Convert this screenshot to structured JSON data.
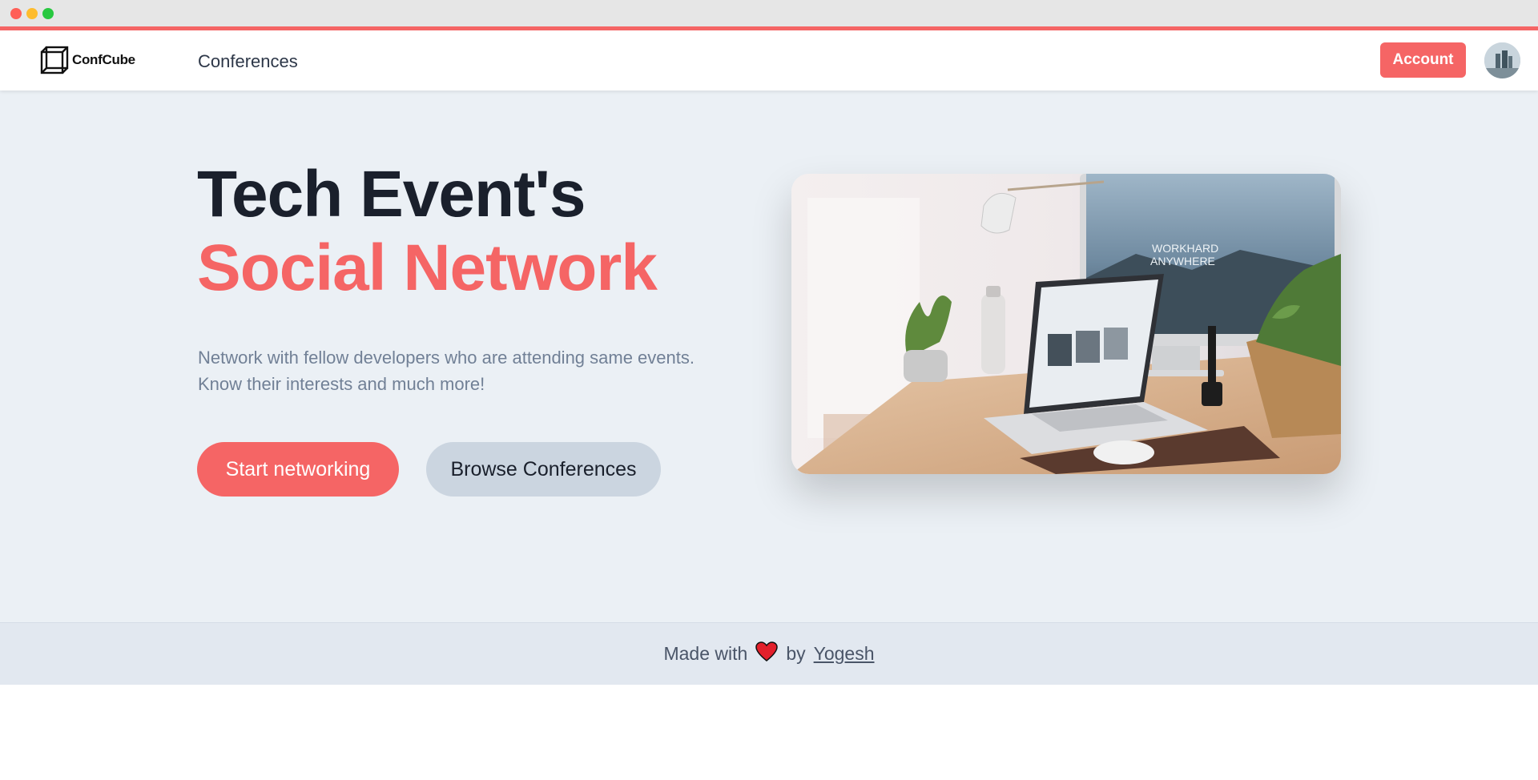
{
  "app": {
    "logo_text": "ConfCube"
  },
  "nav": {
    "conferences_label": "Conferences",
    "account_label": "Account"
  },
  "hero": {
    "title_line1": "Tech Event's",
    "title_line2": "Social Network",
    "subtitle_line1": "Network with fellow developers who are attending same events.",
    "subtitle_line2": "Know their interests and much more!",
    "primary_button": "Start networking",
    "secondary_button": "Browse Conferences",
    "monitor_text_line1": "WORKHARD",
    "monitor_text_line2": "ANYWHERE"
  },
  "footer": {
    "made_with": "Made with",
    "by": "by",
    "author": "Yogesh"
  },
  "colors": {
    "accent": "#f56565",
    "hero_bg": "#ebf0f5",
    "footer_bg": "#e2e8f0",
    "title": "#1a202c"
  }
}
